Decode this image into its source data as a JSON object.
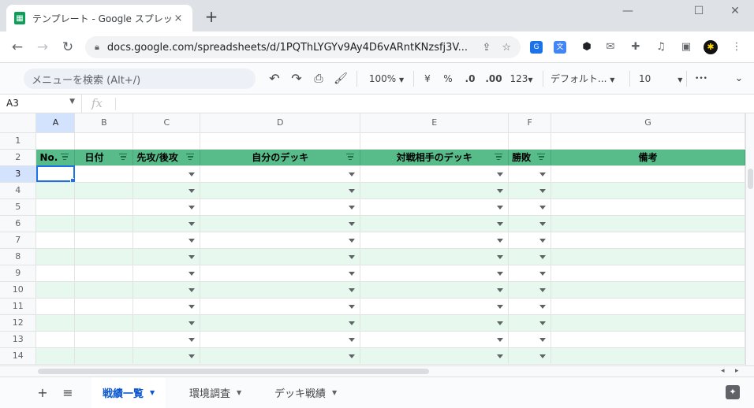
{
  "browser": {
    "tab_title": "テンプレート - Google スプレッドシート",
    "tab_close": "×",
    "new_tab": "+",
    "window_controls": [
      "—",
      "☐",
      "✕"
    ],
    "url": "docs.google.com/spreadsheets/d/1PQThLYGYv9Ay4D6vARntKNzsfj3V...",
    "nav": {
      "back": "←",
      "forward": "→",
      "reload": "↻"
    }
  },
  "sheets_toolbar": {
    "menu_search_placeholder": "メニューを検索 (Alt+/)",
    "zoom": "100%",
    "currency": "¥",
    "percent": "%",
    "dec_decrease": ".0",
    "dec_increase": ".00",
    "format_more": "123",
    "font": "デフォルト...",
    "font_size": "10",
    "more": "•••"
  },
  "formula_bar": {
    "cell_ref": "A3",
    "fx": "fx",
    "value": ""
  },
  "grid": {
    "columns": [
      "A",
      "B",
      "C",
      "D",
      "E",
      "F",
      "G"
    ],
    "selected_column": "A",
    "header_row": {
      "row_number": "2",
      "labels": [
        "No.",
        "日付",
        "先攻/後攻",
        "自分のデッキ",
        "対戦相手のデッキ",
        "勝敗",
        "備考"
      ]
    },
    "rows": [
      "1",
      "3",
      "4",
      "5",
      "6",
      "7",
      "8",
      "9",
      "10",
      "11",
      "12",
      "13",
      "14"
    ],
    "active_row": "3",
    "dropdown_columns": [
      "C",
      "D",
      "E",
      "F"
    ]
  },
  "sheet_tabs": {
    "add": "+",
    "all_sheets": "≡",
    "tabs": [
      {
        "label": "戦績一覧",
        "active": true
      },
      {
        "label": "環境調査",
        "active": false
      },
      {
        "label": "デッキ戦績",
        "active": false
      }
    ]
  },
  "colors": {
    "header_green": "#57bb8a",
    "band_green": "#e7f9ef",
    "selection_blue": "#1a73e8",
    "active_tab_blue": "#0b57d0"
  }
}
